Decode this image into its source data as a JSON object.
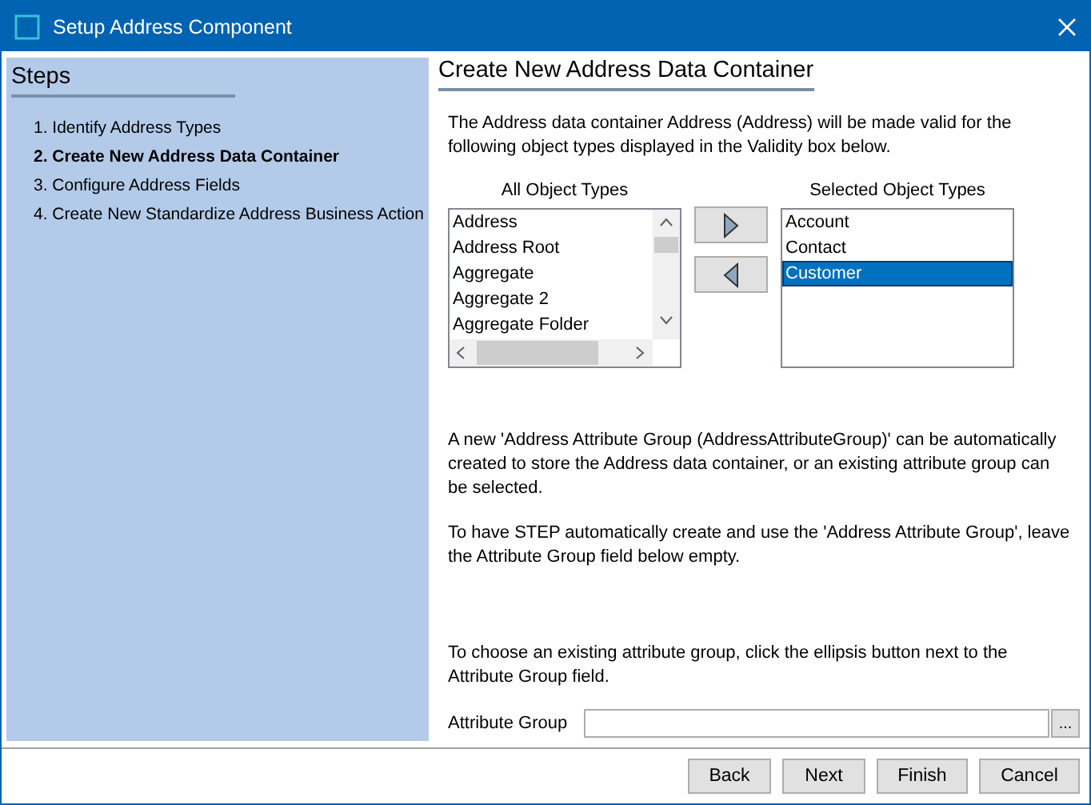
{
  "window": {
    "title": "Setup Address Component"
  },
  "sidebar": {
    "title": "Steps",
    "items": [
      {
        "label": "1. Identify Address Types",
        "selected": false
      },
      {
        "label": "2. Create New Address Data Container",
        "selected": true
      },
      {
        "label": "3. Configure Address Fields",
        "selected": false
      },
      {
        "label": "4. Create New Standardize Address Business Action",
        "selected": false
      }
    ]
  },
  "page": {
    "title": "Create New Address Data Container",
    "intro": "The Address data container Address (Address) will be made valid for the following object types displayed in the Validity box below.",
    "all_types": {
      "label": "All Object Types",
      "items": [
        {
          "label": "Address",
          "selected": false
        },
        {
          "label": "Address Root",
          "selected": false
        },
        {
          "label": "Aggregate",
          "selected": false
        },
        {
          "label": "Aggregate 2",
          "selected": false
        },
        {
          "label": "Aggregate Folder",
          "selected": false
        }
      ]
    },
    "selected_types": {
      "label": "Selected Object Types",
      "items": [
        {
          "label": "Account",
          "selected": false
        },
        {
          "label": "Contact",
          "selected": false
        },
        {
          "label": "Customer",
          "selected": true
        }
      ]
    },
    "paragraphs": [
      "A new 'Address Attribute Group (AddressAttributeGroup)' can be automatically created to store the Address data container, or an existing attribute group can be selected.",
      "To have STEP automatically create and use the 'Address Attribute Group', leave the Attribute Group field below empty.",
      "To choose an existing attribute group, click the ellipsis button next to the Attribute Group field."
    ],
    "attribute_group": {
      "label": "Attribute Group",
      "browse": "..."
    }
  },
  "buttons": [
    "Back",
    "Next",
    "Finish",
    "Cancel"
  ]
}
